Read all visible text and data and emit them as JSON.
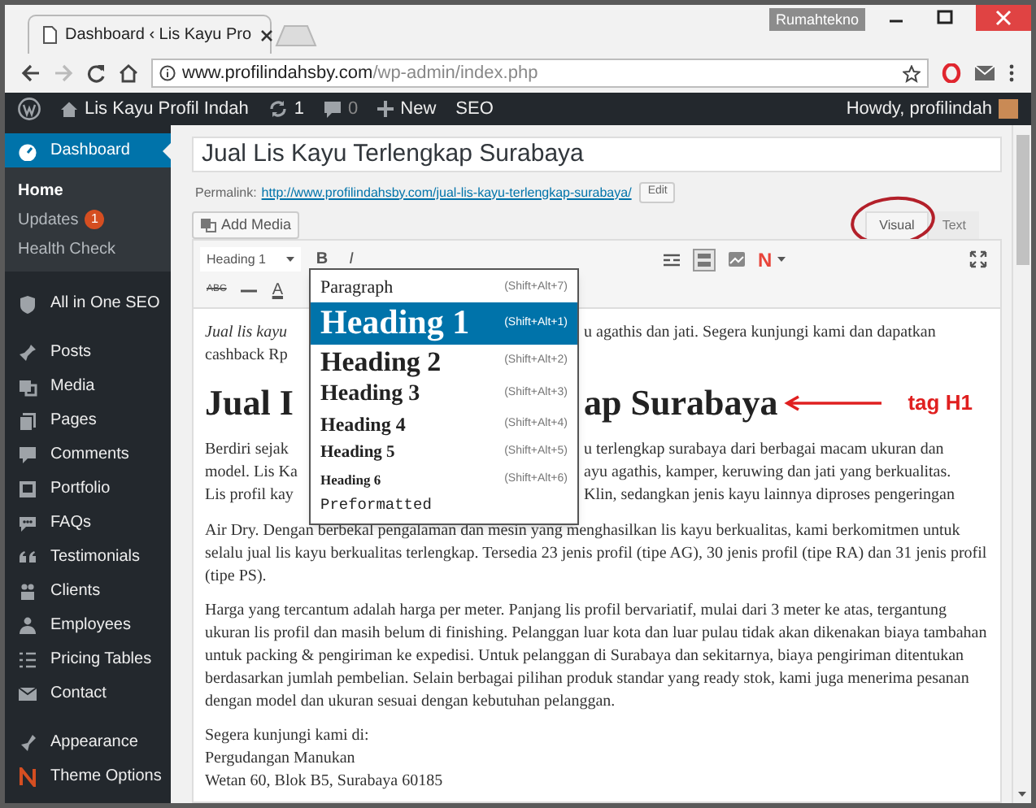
{
  "browser": {
    "tab_title": "Dashboard ‹ Lis Kayu Pro",
    "profile": "Rumahtekno",
    "url_host": "www.profilindahsby.com",
    "url_path": "/wp-admin/index.php"
  },
  "admin_bar": {
    "site_name": "Lis Kayu Profil Indah",
    "updates": "1",
    "comments": "0",
    "new": "New",
    "seo": "SEO",
    "greeting": "Howdy, profilindah"
  },
  "sidebar": {
    "sections": [
      [
        {
          "label": "Dashboard",
          "selected": true,
          "children": [
            {
              "label": "Home",
              "selected": true
            },
            {
              "label": "Updates",
              "badge": "1",
              "selected": false
            },
            {
              "label": "Health Check",
              "selected": false
            }
          ]
        }
      ],
      [
        {
          "label": "All in One SEO",
          "selected": false
        }
      ],
      [
        {
          "label": "Posts",
          "selected": false
        },
        {
          "label": "Media",
          "selected": false
        },
        {
          "label": "Pages",
          "selected": false
        },
        {
          "label": "Comments",
          "selected": false
        },
        {
          "label": "Portfolio",
          "selected": false
        },
        {
          "label": "FAQs",
          "selected": false
        },
        {
          "label": "Testimonials",
          "selected": false
        },
        {
          "label": "Clients",
          "selected": false
        },
        {
          "label": "Employees",
          "selected": false
        },
        {
          "label": "Pricing Tables",
          "selected": false
        },
        {
          "label": "Contact",
          "selected": false
        }
      ],
      [
        {
          "label": "Appearance",
          "selected": false
        },
        {
          "label": "Theme Options",
          "selected": false
        }
      ]
    ]
  },
  "editor": {
    "title": "Jual Lis Kayu Terlengkap Surabaya",
    "permalink_label": "Permalink:",
    "permalink_url": "http://www.profilindahsby.com/jual-lis-kayu-terlengkap-surabaya/",
    "edit_button": "Edit",
    "add_media": "Add Media",
    "tabs": [
      {
        "label": "Visual",
        "selected": true
      },
      {
        "label": "Text",
        "selected": false
      }
    ],
    "toolbar": {
      "format_select": "Heading 1",
      "bold": "B",
      "italic": "I",
      "strike": "ABC",
      "text_color": "A",
      "plugin": "N"
    },
    "format_menu": [
      {
        "kind": "p",
        "label": "Paragraph",
        "shortcut": "(Shift+Alt+7)",
        "selected": false
      },
      {
        "kind": "h1",
        "label": "Heading 1",
        "shortcut": "(Shift+Alt+1)",
        "selected": true
      },
      {
        "kind": "h2",
        "label": "Heading 2",
        "shortcut": "(Shift+Alt+2)",
        "selected": false
      },
      {
        "kind": "h3",
        "label": "Heading 3",
        "shortcut": "(Shift+Alt+3)",
        "selected": false
      },
      {
        "kind": "h4",
        "label": "Heading 4",
        "shortcut": "(Shift+Alt+4)",
        "selected": false
      },
      {
        "kind": "h5",
        "label": "Heading 5",
        "shortcut": "(Shift+Alt+5)",
        "selected": false
      },
      {
        "kind": "h6",
        "label": "Heading 6",
        "shortcut": "(Shift+Alt+6)",
        "selected": false
      },
      {
        "kind": "pre",
        "label": "Preformatted",
        "selected": false
      }
    ],
    "content": [
      {
        "kind": "split",
        "lines": [
          {
            "left": "Jual lis kayu",
            "emphasis": true,
            "right": "u agathis dan jati. Segera kunjungi kami dan dapatkan"
          },
          {
            "left": "cashback Rp"
          }
        ]
      },
      {
        "kind": "heading",
        "left": "Jual I",
        "right": "ap Surabaya",
        "annotation": "tag H1"
      },
      {
        "kind": "split",
        "lines": [
          {
            "left": "Berdiri sejak",
            "right": "u terlengkap surabaya dari berbagai macam ukuran dan"
          },
          {
            "left": "model. Lis Ka",
            "right": "ayu agathis, kamper, keruwing dan jati yang berkualitas."
          },
          {
            "left": "Lis profil kay",
            "right": "Klin, sedangkan jenis kayu lainnya diproses pengeringan"
          }
        ],
        "rest": "Air Dry. Dengan berbekal pengalaman dan mesin yang menghasilkan lis kayu berkualitas, kami berkomitmen untuk selalu jual lis kayu berkualitas terlengkap. Tersedia 23 jenis profil (tipe AG), 30 jenis profil (tipe RA) dan 31 jenis profil (tipe PS)."
      },
      {
        "kind": "paragraph",
        "text": "Harga yang tercantum adalah harga per meter. Panjang lis profil bervariatif, mulai dari 3 meter ke atas, tergantung ukuran lis profil dan masih belum di finishing. Pelanggan luar kota dan luar pulau tidak akan dikenakan biaya tambahan untuk packing & pengiriman ke expedisi. Untuk pelanggan di Surabaya dan sekitarnya, biaya pengiriman ditentukan berdasarkan jumlah pembelian. Selain berbagai pilihan produk standar yang ready stok, kami juga menerima pesanan dengan model dan ukuran sesuai dengan kebutuhan pelanggan."
      },
      {
        "kind": "lines",
        "lines": [
          "Segera kunjungi kami di:",
          "Pergudangan Manukan",
          "Wetan 60, Blok B5, Surabaya 60185"
        ]
      }
    ]
  }
}
